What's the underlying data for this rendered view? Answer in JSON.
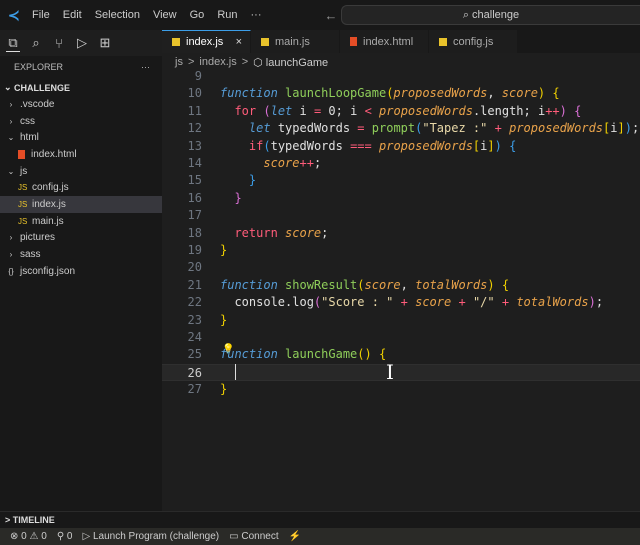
{
  "menu": [
    "File",
    "Edit",
    "Selection",
    "View",
    "Go",
    "Run",
    "···"
  ],
  "search": "⌕ challenge",
  "nav": "← →",
  "activity": [
    "⧉",
    "⌕",
    "⑂",
    "▷",
    "⊞"
  ],
  "explorer": {
    "title": "EXPLORER",
    "more": "···",
    "section": "CHALLENGE",
    "items": [
      {
        "label": ".vscode",
        "icon": "›",
        "indent": 1
      },
      {
        "label": "css",
        "icon": "›",
        "indent": 1
      },
      {
        "label": "html",
        "icon": "⌄",
        "indent": 1
      },
      {
        "label": "index.html",
        "icon": "html",
        "indent": 2
      },
      {
        "label": "js",
        "icon": "⌄",
        "indent": 1
      },
      {
        "label": "config.js",
        "icon": "js",
        "indent": 2
      },
      {
        "label": "index.js",
        "icon": "js",
        "indent": 2,
        "selected": true
      },
      {
        "label": "main.js",
        "icon": "js",
        "indent": 2
      },
      {
        "label": "pictures",
        "icon": "›",
        "indent": 1
      },
      {
        "label": "sass",
        "icon": "›",
        "indent": 1
      },
      {
        "label": "jsconfig.json",
        "icon": "{}",
        "indent": 1
      }
    ]
  },
  "tabs": [
    {
      "label": "index.js",
      "type": "js",
      "active": true,
      "close": "×"
    },
    {
      "label": "main.js",
      "type": "js"
    },
    {
      "label": "index.html",
      "type": "html"
    },
    {
      "label": "config.js",
      "type": "js"
    }
  ],
  "breadcrumb": [
    "js",
    ">",
    "index.js",
    ">",
    "⬡ launchGame"
  ],
  "code": [
    {
      "n": 9,
      "t": []
    },
    {
      "n": 10,
      "t": [
        [
          "kw",
          "function "
        ],
        [
          "fn",
          "launchLoopGame"
        ],
        [
          "b1",
          "("
        ],
        [
          "par",
          "proposedWords"
        ],
        [
          "plain",
          ", "
        ],
        [
          "par",
          "score"
        ],
        [
          "b1",
          ")"
        ],
        [
          "plain",
          " "
        ],
        [
          "b1",
          "{"
        ]
      ]
    },
    {
      "n": 11,
      "t": [
        [
          "plain",
          "  "
        ],
        [
          "ctl",
          "for "
        ],
        [
          "b2",
          "("
        ],
        [
          "kw",
          "let"
        ],
        [
          "plain",
          " i "
        ],
        [
          "op",
          "="
        ],
        [
          "plain",
          " 0; i "
        ],
        [
          "op",
          "<"
        ],
        [
          "plain",
          " "
        ],
        [
          "par",
          "proposedWords"
        ],
        [
          "plain",
          ".length; i"
        ],
        [
          "op",
          "++"
        ],
        [
          "b2",
          ")"
        ],
        [
          "plain",
          " "
        ],
        [
          "b2",
          "{"
        ]
      ]
    },
    {
      "n": 12,
      "t": [
        [
          "plain",
          "    "
        ],
        [
          "kw",
          "let"
        ],
        [
          "plain",
          " typedWords "
        ],
        [
          "op",
          "="
        ],
        [
          "plain",
          " "
        ],
        [
          "fn",
          "prompt"
        ],
        [
          "b3",
          "("
        ],
        [
          "str",
          "\"Tapez :\""
        ],
        [
          "plain",
          " "
        ],
        [
          "op",
          "+"
        ],
        [
          "plain",
          " "
        ],
        [
          "par",
          "proposedWords"
        ],
        [
          "b1",
          "["
        ],
        [
          "plain",
          "i"
        ],
        [
          "b1",
          "]"
        ],
        [
          "b3",
          ")"
        ],
        [
          "plain",
          ";"
        ]
      ]
    },
    {
      "n": 13,
      "t": [
        [
          "plain",
          "    "
        ],
        [
          "ctl",
          "if"
        ],
        [
          "b3",
          "("
        ],
        [
          "plain",
          "typedWords "
        ],
        [
          "op",
          "==="
        ],
        [
          "plain",
          " "
        ],
        [
          "par",
          "proposedWords"
        ],
        [
          "b1",
          "["
        ],
        [
          "plain",
          "i"
        ],
        [
          "b1",
          "]"
        ],
        [
          "b3",
          ")"
        ],
        [
          "plain",
          " "
        ],
        [
          "b3",
          "{"
        ]
      ]
    },
    {
      "n": 14,
      "t": [
        [
          "plain",
          "      "
        ],
        [
          "par",
          "score"
        ],
        [
          "op",
          "++"
        ],
        [
          "plain",
          ";"
        ]
      ]
    },
    {
      "n": 15,
      "t": [
        [
          "plain",
          "    "
        ],
        [
          "b3",
          "}"
        ]
      ]
    },
    {
      "n": 16,
      "t": [
        [
          "plain",
          "  "
        ],
        [
          "b2",
          "}"
        ]
      ]
    },
    {
      "n": 17,
      "t": []
    },
    {
      "n": 18,
      "t": [
        [
          "plain",
          "  "
        ],
        [
          "ctl",
          "return "
        ],
        [
          "par",
          "score"
        ],
        [
          "plain",
          ";"
        ]
      ]
    },
    {
      "n": 19,
      "t": [
        [
          "b1",
          "}"
        ]
      ]
    },
    {
      "n": 20,
      "t": []
    },
    {
      "n": 21,
      "t": [
        [
          "kw",
          "function "
        ],
        [
          "fn",
          "showResult"
        ],
        [
          "b1",
          "("
        ],
        [
          "par",
          "score"
        ],
        [
          "plain",
          ", "
        ],
        [
          "par",
          "totalWords"
        ],
        [
          "b1",
          ")"
        ],
        [
          "plain",
          " "
        ],
        [
          "b1",
          "{"
        ]
      ]
    },
    {
      "n": 22,
      "t": [
        [
          "plain",
          "  console.log"
        ],
        [
          "b2",
          "("
        ],
        [
          "str",
          "\"Score : \""
        ],
        [
          "plain",
          " "
        ],
        [
          "op",
          "+"
        ],
        [
          "plain",
          " "
        ],
        [
          "par",
          "score"
        ],
        [
          "plain",
          " "
        ],
        [
          "op",
          "+"
        ],
        [
          "plain",
          " "
        ],
        [
          "str",
          "\"/\""
        ],
        [
          "plain",
          " "
        ],
        [
          "op",
          "+"
        ],
        [
          "plain",
          " "
        ],
        [
          "par",
          "totalWords"
        ],
        [
          "b2",
          ")"
        ],
        [
          "plain",
          ";"
        ]
      ]
    },
    {
      "n": 23,
      "t": [
        [
          "b1",
          "}"
        ]
      ]
    },
    {
      "n": 24,
      "t": []
    },
    {
      "n": 25,
      "t": [
        [
          "kw",
          "function "
        ],
        [
          "fn",
          "launchGame"
        ],
        [
          "b1",
          "()"
        ],
        [
          "plain",
          " "
        ],
        [
          "b1",
          "{"
        ]
      ]
    },
    {
      "n": 26,
      "t": [],
      "current": true
    },
    {
      "n": 27,
      "t": [
        [
          "b1",
          "}"
        ]
      ]
    }
  ],
  "timeline": "> TIMELINE",
  "status": [
    "⊗ 0 ⚠ 0",
    "⚲ 0",
    "▷ Launch Program (challenge)",
    "▭ Connect",
    "⚡"
  ]
}
